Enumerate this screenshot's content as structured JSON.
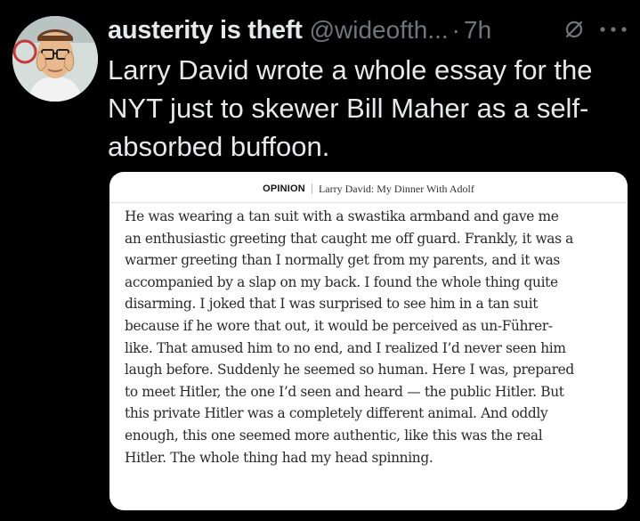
{
  "tweet": {
    "author": {
      "display_name": "austerity is theft",
      "handle": "@wideofth...",
      "avatar_icon": "avatar-icon"
    },
    "separator": "·",
    "time": "7h",
    "mute_icon": "mute-icon",
    "more_icon": "more-icon",
    "text_lines": [
      "Larry David wrote a whole essay for the",
      "NYT just to skewer Bill Maher as a self-",
      "absorbed buffoon."
    ]
  },
  "card": {
    "section_label": "OPINION",
    "article_title": "Larry David: My Dinner With Adolf",
    "excerpt_lines": [
      "He was wearing a tan suit with a swastika armband and gave me",
      "an enthusiastic greeting that caught me off guard. Frankly, it was a",
      "warmer greeting than I normally get from my parents, and it was",
      "accompanied by a slap on my back. I found the whole thing quite",
      "disarming. I joked that I was surprised to see him in a tan suit",
      "because if he wore that out, it would be perceived as un-Führer-",
      "like. That amused him to no end, and I realized I’d never seen him",
      "laugh before. Suddenly he seemed so human. Here I was, prepared",
      "to meet Hitler, the one I’d seen and heard — the public Hitler. But",
      "this private Hitler was a completely different animal. And oddly",
      "enough, this one seemed more authentic, like this was the real",
      "Hitler. The whole thing had my head spinning."
    ]
  },
  "colors": {
    "background": "#000000",
    "primary_text": "#e7e9ea",
    "secondary_text": "#71767b",
    "card_background": "#ffffff"
  }
}
